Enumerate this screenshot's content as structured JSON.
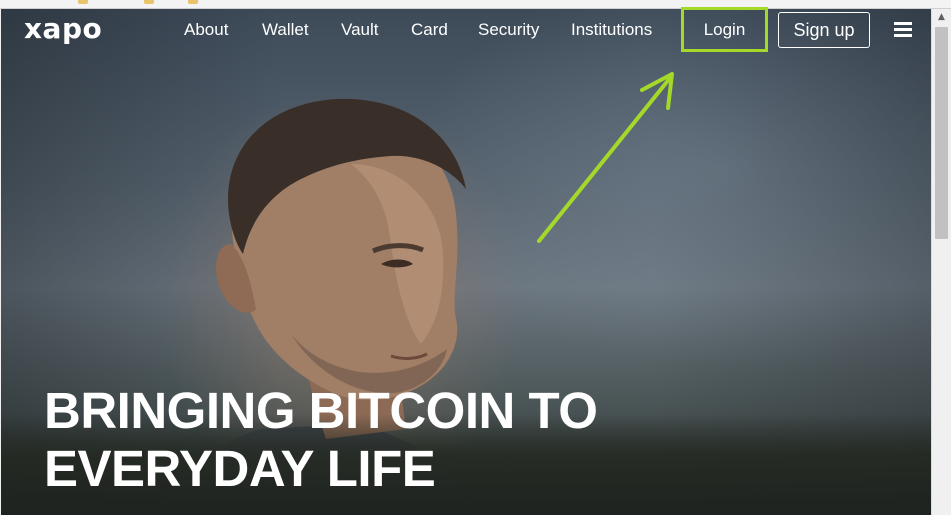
{
  "header": {
    "logo": "xapo",
    "nav": [
      "About",
      "Wallet",
      "Vault",
      "Card",
      "Security",
      "Institutions"
    ],
    "login_label": "Login",
    "signup_label": "Sign up",
    "menu_icon": "hamburger-menu-icon"
  },
  "annotation": {
    "highlight_color": "#a4d92a"
  },
  "hero": {
    "title_line1": "BRINGING BITCOIN TO",
    "title_line2": "EVERYDAY LIFE"
  }
}
